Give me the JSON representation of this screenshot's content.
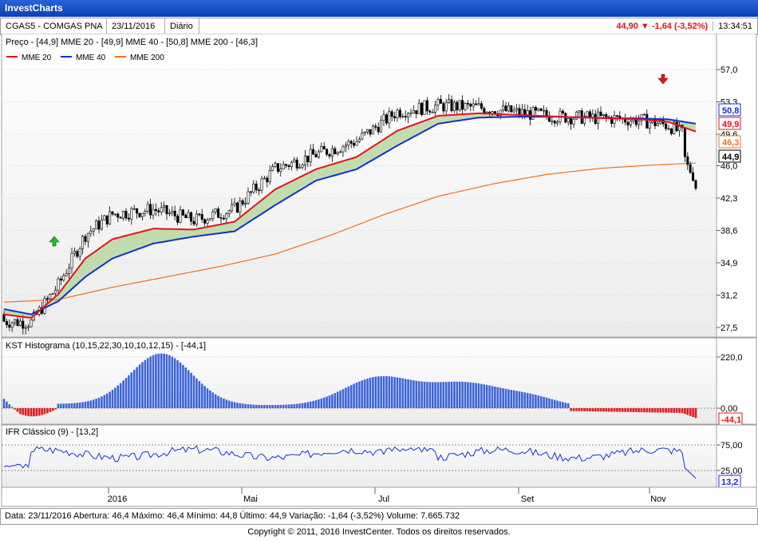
{
  "app": {
    "title": "InvestCharts"
  },
  "info": {
    "symbol": "CGAS5 - COMGAS PNA",
    "date": "23/11/2016",
    "period": "Diário",
    "quote": "44,90 ▼ -1,64 (-3,52%)",
    "time": "13:34:51"
  },
  "price_panel": {
    "header": "Preço - [44,9]    MME 20 - [49,9]    MME 40 - [50,8]    MME 200 - [46,3]",
    "legend": [
      {
        "name": "MME 20",
        "color": "#e8101e"
      },
      {
        "name": "MME 40",
        "color": "#1030d0"
      },
      {
        "name": "MME 200",
        "color": "#f07020"
      }
    ],
    "y_ticks": [
      "57,0",
      "53,3",
      "49,6",
      "46,0",
      "42,3",
      "38,6",
      "34,9",
      "31,2",
      "27,5"
    ],
    "badges": [
      {
        "text": "50,8",
        "color": "#1030d0"
      },
      {
        "text": "49,9",
        "color": "#e8101e"
      },
      {
        "text": "46,3",
        "color": "#f07020"
      },
      {
        "text": "44,9",
        "color": "#000000"
      }
    ]
  },
  "kst_panel": {
    "header": "KST Histograma (10,15,22,30,10,10,12,15) - [-44,1]",
    "y_ticks": [
      "220,0",
      "0,00"
    ],
    "badge": "-44,1"
  },
  "ifr_panel": {
    "header": "IFR Clássico (9) - [13,2]",
    "y_ticks": [
      "75,00",
      "25,00"
    ],
    "badge": "13,2"
  },
  "x_labels": [
    "2016",
    "Mai",
    "Jul",
    "Set",
    "Nov"
  ],
  "footer": {
    "text": "Data: 23/11/2016  Abertura: 46,4  Máximo: 46,4  Mínimo: 44,8  Último: 44,9  Variação: -1,64 (-3,52%)  Volume: 7.665.732"
  },
  "copyright": "Copyright © 2011, 2016  InvestCenter. Todos os direitos reservados.",
  "colors": {
    "mme20": "#e8101e",
    "mme40": "#1030d0",
    "mme200": "#f07020",
    "fill": "#b8d8a0",
    "hist_pos": "#3c64d8",
    "hist_neg": "#e01818",
    "ifr": "#1c30d8"
  },
  "chart_data": {
    "type": "line",
    "title": "",
    "x_labels": [
      "2016",
      "Mai",
      "Jul",
      "Set",
      "Nov"
    ],
    "ylim": [
      27.5,
      57.0
    ],
    "series": [
      {
        "name": "MME 20",
        "x": [
          0,
          10,
          20,
          30,
          40,
          55,
          70,
          85,
          100,
          115,
          130,
          145,
          160,
          175,
          190,
          205,
          215,
          225,
          235,
          245,
          255
        ],
        "values": [
          29.0,
          28.6,
          31.3,
          35.4,
          37.6,
          38.8,
          38.7,
          39.6,
          43.3,
          45.6,
          47.0,
          50.0,
          51.7,
          52.0,
          51.8,
          51.6,
          51.5,
          51.4,
          51.3,
          51.0,
          49.9
        ]
      },
      {
        "name": "MME 40",
        "x": [
          0,
          10,
          20,
          30,
          40,
          55,
          70,
          85,
          100,
          115,
          130,
          145,
          160,
          175,
          190,
          205,
          215,
          225,
          235,
          245,
          255
        ],
        "values": [
          29.6,
          29.0,
          30.5,
          33.3,
          35.4,
          37.1,
          37.9,
          38.5,
          41.5,
          44.3,
          45.6,
          48.3,
          50.8,
          51.5,
          51.6,
          51.6,
          51.5,
          51.4,
          51.4,
          51.3,
          50.8
        ]
      },
      {
        "name": "MME 200",
        "x": [
          0,
          20,
          40,
          60,
          80,
          100,
          120,
          140,
          160,
          180,
          200,
          220,
          240,
          255
        ],
        "values": [
          30.4,
          30.7,
          32.1,
          33.3,
          34.5,
          35.9,
          38.0,
          40.4,
          42.5,
          43.9,
          45.0,
          45.7,
          46.1,
          46.3
        ]
      }
    ],
    "kst": {
      "name": "KST Histograma",
      "last": -44.1,
      "ylim": [
        -60,
        230
      ]
    },
    "ifr": {
      "name": "IFR Clássico (9)",
      "last": 13.2,
      "levels": [
        75,
        25
      ]
    }
  }
}
